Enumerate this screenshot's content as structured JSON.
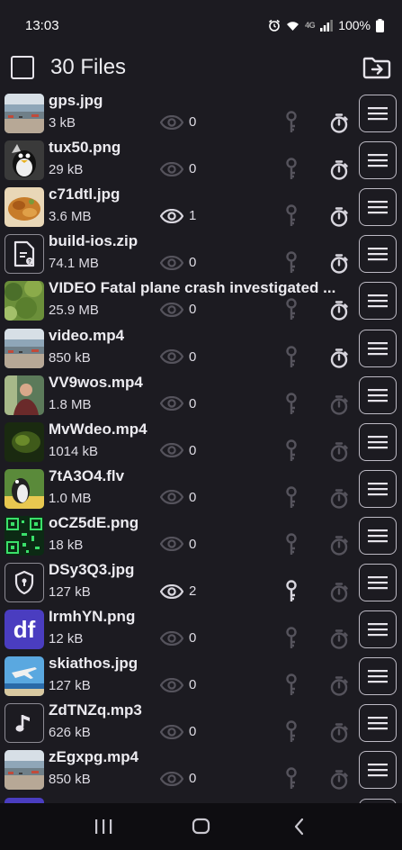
{
  "status_bar": {
    "time": "13:03",
    "battery": "100%",
    "network": "4G"
  },
  "header": {
    "title": "30 Files"
  },
  "colors": {
    "background": "#1c1b21",
    "icon_active": "#d8d6de",
    "icon_dim": "#55535c"
  },
  "files": [
    {
      "name": "gps.jpg",
      "size": "3 kB",
      "views": "0",
      "viewed": false,
      "key_active": false,
      "timer_active": true,
      "thumb": "harbor"
    },
    {
      "name": "tux50.png",
      "size": "29 kB",
      "views": "0",
      "viewed": false,
      "key_active": false,
      "timer_active": true,
      "thumb": "penguin"
    },
    {
      "name": "c71dtl.jpg",
      "size": "3.6 MB",
      "views": "1",
      "viewed": true,
      "key_active": false,
      "timer_active": true,
      "thumb": "food"
    },
    {
      "name": "build-ios.zip",
      "size": "74.1 MB",
      "views": "0",
      "viewed": false,
      "key_active": false,
      "timer_active": true,
      "thumb": "file-archive-icon"
    },
    {
      "name": "VIDEO Fatal plane crash investigated ...",
      "size": "25.9 MB",
      "views": "0",
      "viewed": false,
      "key_active": false,
      "timer_active": true,
      "thumb": "trees"
    },
    {
      "name": "video.mp4",
      "size": "850 kB",
      "views": "0",
      "viewed": false,
      "key_active": false,
      "timer_active": true,
      "thumb": "harbor"
    },
    {
      "name": "VV9wos.mp4",
      "size": "1.8 MB",
      "views": "0",
      "viewed": false,
      "key_active": false,
      "timer_active": false,
      "thumb": "person"
    },
    {
      "name": "MvWdeo.mp4",
      "size": "1014 kB",
      "views": "0",
      "viewed": false,
      "key_active": false,
      "timer_active": false,
      "thumb": "dark"
    },
    {
      "name": "7tA3O4.flv",
      "size": "1.0 MB",
      "views": "0",
      "viewed": false,
      "key_active": false,
      "timer_active": false,
      "thumb": "penguin2"
    },
    {
      "name": "oCZ5dE.png",
      "size": "18 kB",
      "views": "0",
      "viewed": false,
      "key_active": false,
      "timer_active": false,
      "thumb": "qr"
    },
    {
      "name": "DSy3Q3.jpg",
      "size": "127 kB",
      "views": "2",
      "viewed": true,
      "key_active": true,
      "timer_active": false,
      "thumb": "shield-icon"
    },
    {
      "name": "IrmhYN.png",
      "size": "12 kB",
      "views": "0",
      "viewed": false,
      "key_active": false,
      "timer_active": false,
      "thumb": "df"
    },
    {
      "name": "skiathos.jpg",
      "size": "127 kB",
      "views": "0",
      "viewed": false,
      "key_active": false,
      "timer_active": false,
      "thumb": "plane"
    },
    {
      "name": "ZdTNZq.mp3",
      "size": "626 kB",
      "views": "0",
      "viewed": false,
      "key_active": false,
      "timer_active": false,
      "thumb": "music-note-icon"
    },
    {
      "name": "zEgxpg.mp4",
      "size": "850 kB",
      "views": "0",
      "viewed": false,
      "key_active": false,
      "timer_active": false,
      "thumb": "harbor"
    }
  ],
  "thumb_text": {
    "df": "df"
  }
}
